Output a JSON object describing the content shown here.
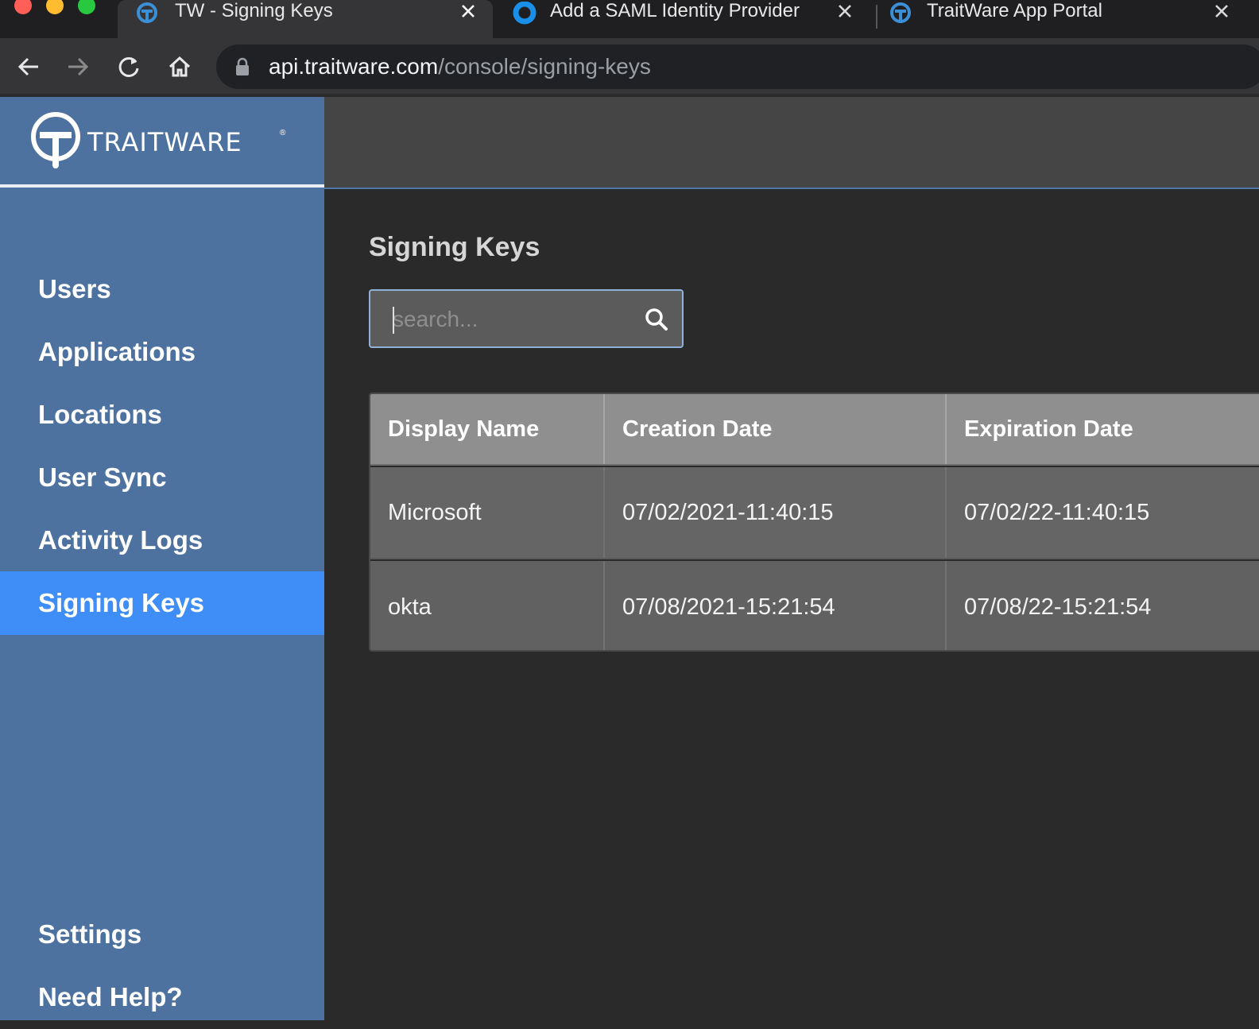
{
  "browser": {
    "tabs": [
      {
        "title": "TW - Signing Keys",
        "active": true,
        "icon": "traitware-favicon-icon"
      },
      {
        "title": "Add a SAML Identity Provider",
        "active": false,
        "icon": "okta-favicon-icon"
      },
      {
        "title": "TraitWare App Portal",
        "active": false,
        "icon": "traitware-favicon-icon"
      }
    ],
    "url_host": "api.traitware.com",
    "url_path": "/console/signing-keys"
  },
  "sidebar": {
    "logo_text": "TRAITWARE",
    "logo_mark": "®",
    "items": [
      {
        "label": "Users"
      },
      {
        "label": "Applications"
      },
      {
        "label": "Locations"
      },
      {
        "label": "User Sync"
      },
      {
        "label": "Activity Logs"
      },
      {
        "label": "Signing Keys",
        "active": true
      }
    ],
    "bottom_items": [
      {
        "label": "Settings"
      },
      {
        "label": "Need Help?"
      }
    ]
  },
  "main": {
    "title": "Signing Keys",
    "search": {
      "placeholder": "search..."
    },
    "table": {
      "columns": [
        "Display Name",
        "Creation Date",
        "Expiration Date"
      ],
      "rows": [
        [
          "Microsoft",
          "07/02/2021-11:40:15",
          "07/02/22-11:40:15"
        ],
        [
          "okta",
          "07/08/2021-15:21:54",
          "07/08/22-15:21:54"
        ]
      ]
    }
  },
  "colors": {
    "sidebar": "#4e729f",
    "active_nav": "#3f8ef7",
    "content_bg": "#2a2a2a",
    "topbar": "#454545"
  }
}
